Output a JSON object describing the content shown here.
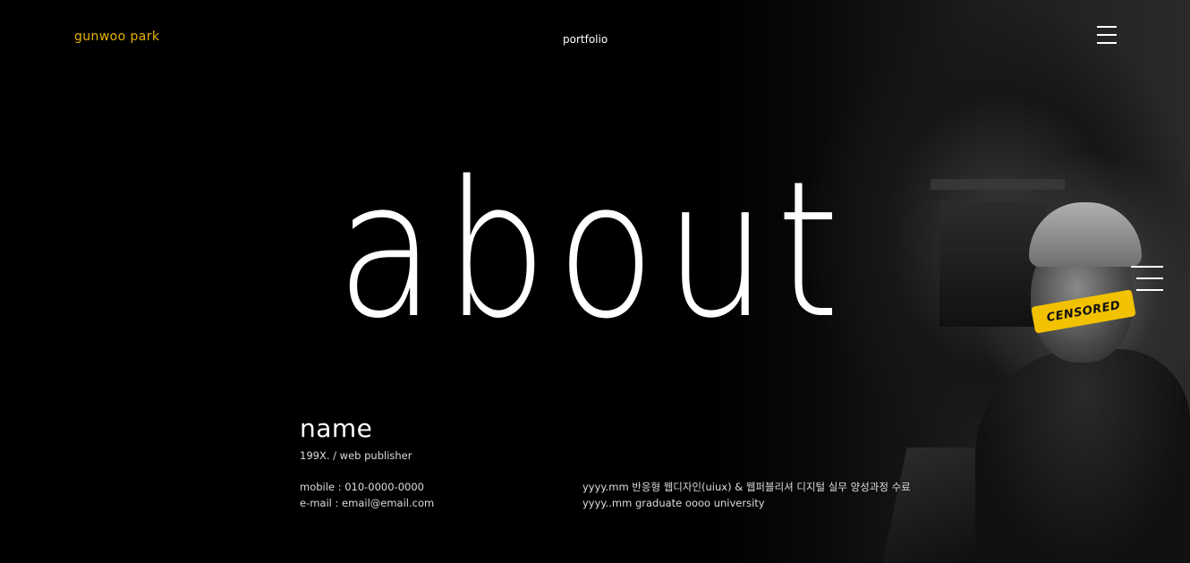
{
  "header": {
    "logo": "gunwoo park",
    "title": "portfolio",
    "menu_icon": "hamburger-menu-icon"
  },
  "hero": {
    "title": "about"
  },
  "photo": {
    "censor_label": "CENSORED",
    "accent_color": "#f2c200"
  },
  "profile": {
    "name": "name",
    "subtitle": "199X. / web publisher",
    "contact": [
      "mobile : 010-0000-0000",
      "e-mail : email@email.com"
    ],
    "history": [
      "yyyy.mm 반응형 웹디자인(uiux) & 웹퍼블리셔 디지털 실무 양성과정 수료",
      "yyyy..mm graduate oooo university"
    ]
  },
  "colors": {
    "background": "#000000",
    "logo": "#e8b400",
    "text": "#ffffff"
  }
}
